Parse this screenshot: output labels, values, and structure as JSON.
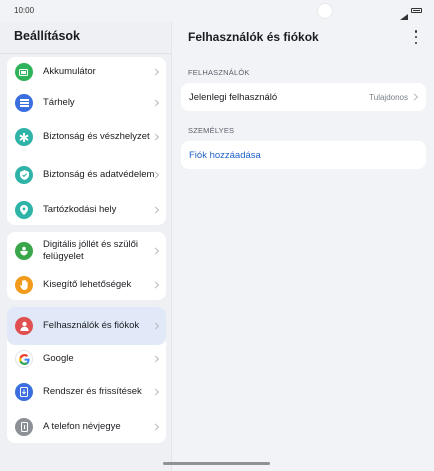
{
  "status": {
    "time": "10:00"
  },
  "left": {
    "title": "Beállítások",
    "groups": [
      [
        {
          "label": "Akkumulátor",
          "icon": "battery-icon",
          "color": "#2fb35a"
        },
        {
          "label": "Tárhely",
          "icon": "storage-icon",
          "color": "#3b6fe0"
        },
        {
          "label": "Biztonság és vészhelyzet",
          "icon": "emergency-icon",
          "color": "#2fb3a8"
        },
        {
          "label": "Biztonság és adatvédelem",
          "icon": "shield-icon",
          "color": "#2fb3a8"
        },
        {
          "label": "Tartózkodási hely",
          "icon": "location-icon",
          "color": "#2fb3a8"
        }
      ],
      [
        {
          "label": "Digitális jóllét és szülői felügyelet",
          "icon": "wellbeing-icon",
          "color": "#39a64a"
        },
        {
          "label": "Kisegítő lehetőségek",
          "icon": "hand-icon",
          "color": "#f29a1a"
        }
      ],
      [
        {
          "label": "Felhasználók és fiókok",
          "icon": "user-icon",
          "color": "#e05050"
        },
        {
          "label": "Google",
          "icon": "google-icon",
          "color": "#ffffff"
        },
        {
          "label": "Rendszer és frissítések",
          "icon": "system-update-icon",
          "color": "#3b6fe0"
        },
        {
          "label": "A telefon névjegye",
          "icon": "phone-info-icon",
          "color": "#8c9097"
        }
      ]
    ]
  },
  "right": {
    "title": "Felhasználók és fiókok",
    "section_users": "FELHASZNÁLÓK",
    "current_user_label": "Jelenlegi felhasználó",
    "current_user_value": "Tulajdonos",
    "section_personal": "SZEMÉLYES",
    "add_account_label": "Fiók hozzáadása"
  },
  "colors": {
    "link": "#1f5fc9",
    "selected_bg": "#e1e9f8"
  }
}
